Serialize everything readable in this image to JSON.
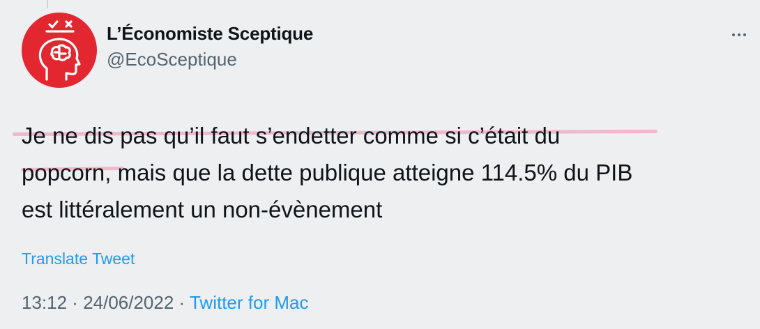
{
  "author": {
    "display_name": "L’Économiste Sceptique",
    "handle": "@EcoSceptique"
  },
  "tweet": {
    "line1": "Je ne dis pas qu’il faut s’endetter comme si c’était du",
    "line2_start": "popcorn",
    "line2_rest": ", mais que la dette publique atteigne 114.5% du PIB",
    "line3": "est littéralement un non-évènement"
  },
  "actions": {
    "translate": "Translate Tweet"
  },
  "meta": {
    "time": "13:12",
    "separator1": " · ",
    "date": "24/06/2022",
    "separator2": " · ",
    "source": "Twitter for Mac"
  },
  "colors": {
    "avatar_bg": "#e32731",
    "link": "#1d9bf0",
    "highlight": "#f0a2b8"
  },
  "icons": {
    "avatar": "brain-head-icon",
    "more": "more-dots-icon"
  }
}
